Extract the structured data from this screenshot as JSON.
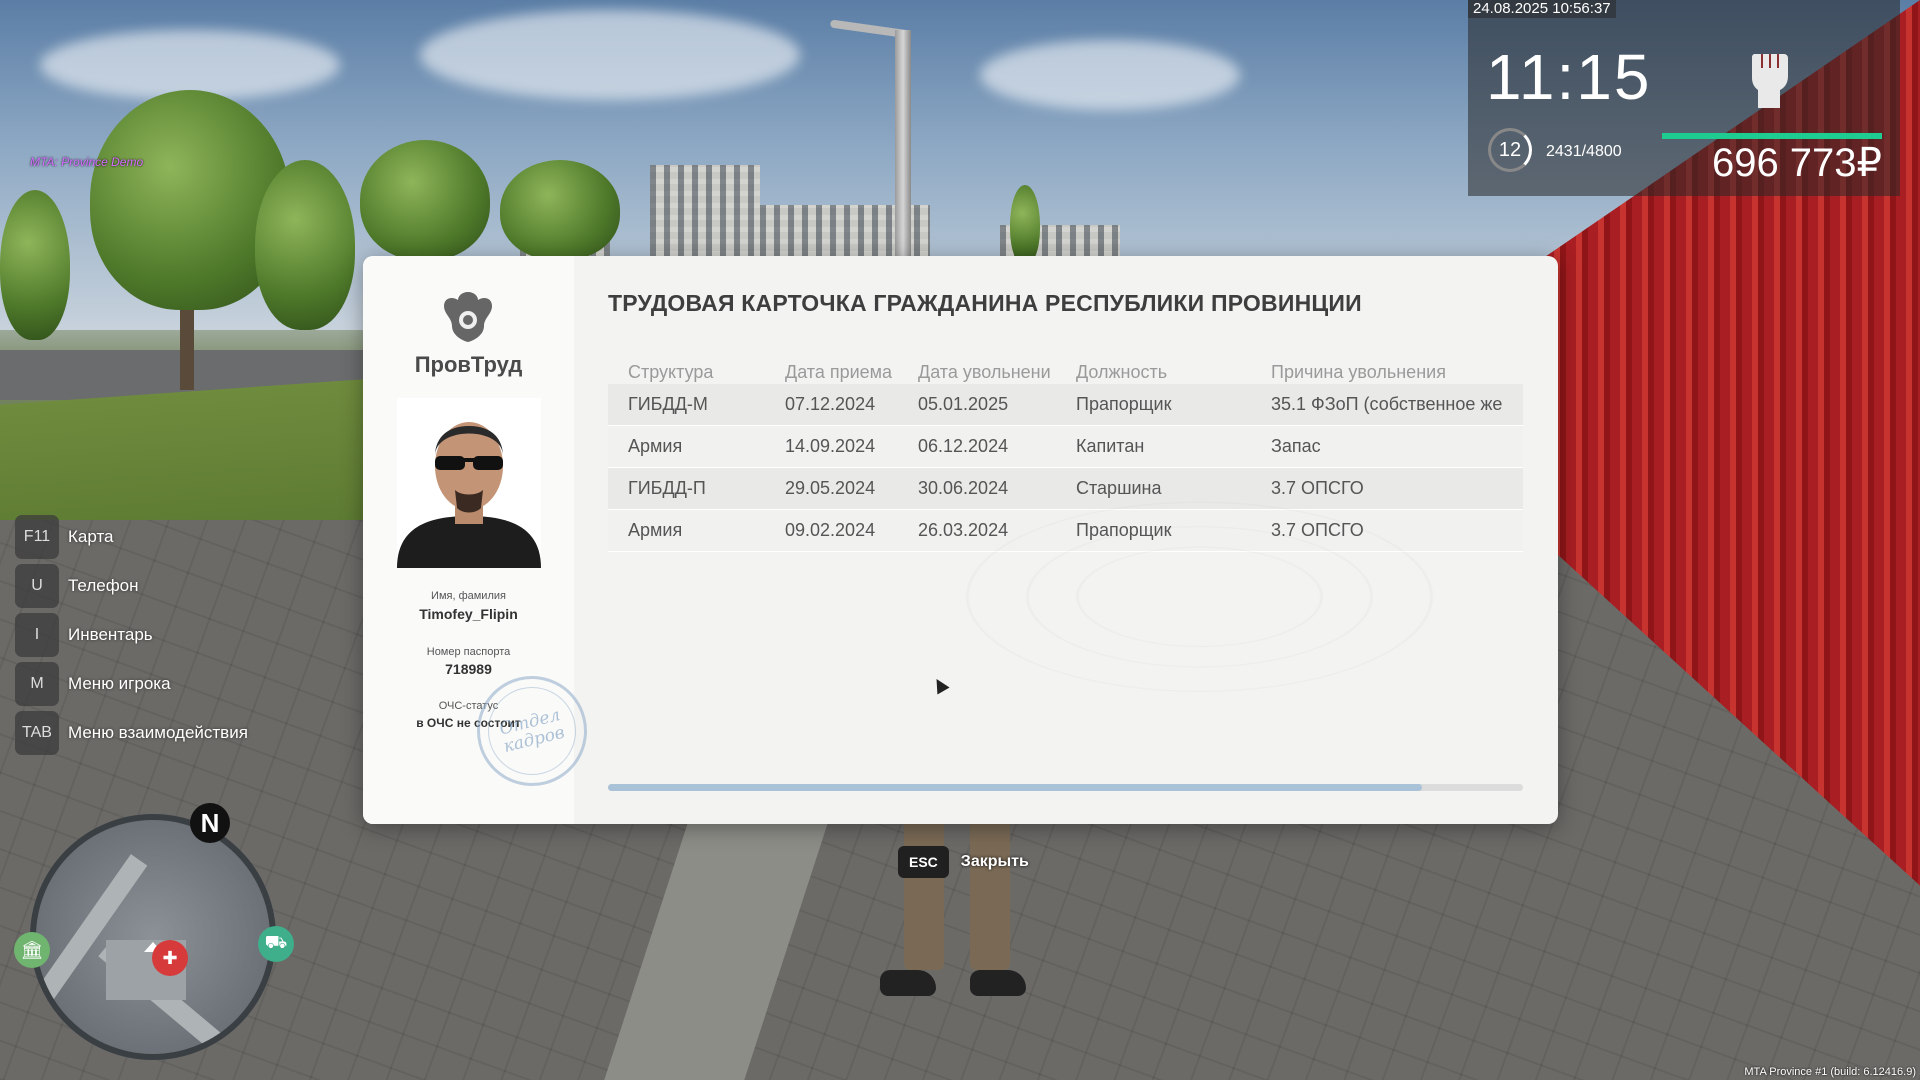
{
  "server_tag": "MTA: Province Demo",
  "build_info": "MTA Province #1 (build: 6.12416.9)",
  "hud": {
    "datetime": "24.08.2025 10:56:37",
    "time": "11:15",
    "level": "12",
    "xp": "2431/4800",
    "money": "696 773₽",
    "accent_color": "#1ecb91",
    "fist_icon": "raised-fist-icon"
  },
  "hints": [
    {
      "key": "F11",
      "label": "Карта"
    },
    {
      "key": "U",
      "label": "Телефон"
    },
    {
      "key": "I",
      "label": "Инвентарь"
    },
    {
      "key": "M",
      "label": "Меню игрока"
    },
    {
      "key": "TAB",
      "label": "Меню взаимодействия"
    }
  ],
  "minimap": {
    "north": "N"
  },
  "card": {
    "brand": "ПровТруд",
    "title": "ТРУДОВАЯ КАРТОЧКА ГРАЖДАНИНА РЕСПУБЛИКИ ПРОВИНЦИИ",
    "name_label": "Имя, фамилия",
    "name_value": "Timofey_Flipin",
    "passport_label": "Номер паспорта",
    "passport_value": "718989",
    "ochs_label": "ОЧС-статус",
    "ochs_value": "в ОЧС не состоит",
    "stamp_line1": "Отдел",
    "stamp_line2": "кадров",
    "columns": [
      "Структура",
      "Дата приема",
      "Дата увольнени",
      "Должность",
      "Причина увольнения"
    ],
    "rows": [
      [
        "ГИБДД-М",
        "07.12.2024",
        "05.01.2025",
        "Прапорщик",
        "35.1 ФЗоП (собственное же"
      ],
      [
        "Армия",
        "14.09.2024",
        "06.12.2024",
        "Капитан",
        "Запас"
      ],
      [
        "ГИБДД-П",
        "29.05.2024",
        "30.06.2024",
        "Старшина",
        "3.7 ОПСГО"
      ],
      [
        "Армия",
        "09.02.2024",
        "26.03.2024",
        "Прапорщик",
        "3.7 ОПСГО"
      ]
    ],
    "scroll_fraction": 0.89
  },
  "close": {
    "key": "ESC",
    "label": "Закрыть"
  }
}
